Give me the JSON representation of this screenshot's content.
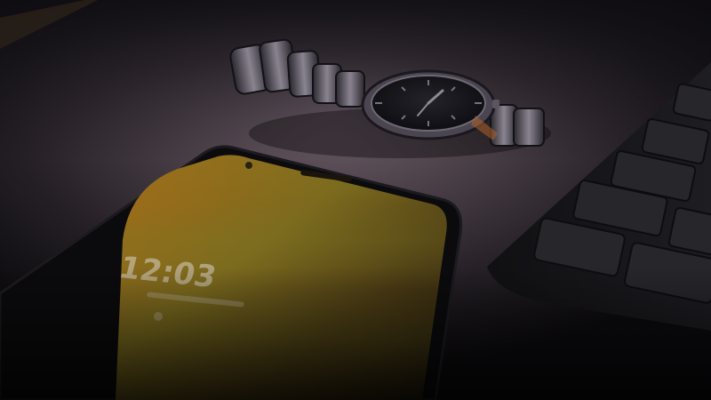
{
  "scene": {
    "phone": {
      "lock_screen_time": "12:03"
    },
    "palette": {
      "desk_highlight": "#6e5f6a",
      "desk_mid": "#3a3238",
      "desk_shadow": "#0c0b0e",
      "screen_glow_warm": "#a86d18",
      "screen_glow_olive": "#7c7a22",
      "phone_body": "#0b0b0d",
      "watch_metal": "#8a8490",
      "watch_dial": "#15151a",
      "keyboard_body": "#18181c",
      "keyboard_key": "#26262b"
    },
    "icons": [
      "smartphone-icon",
      "wristwatch-icon",
      "keyboard-icon"
    ]
  }
}
